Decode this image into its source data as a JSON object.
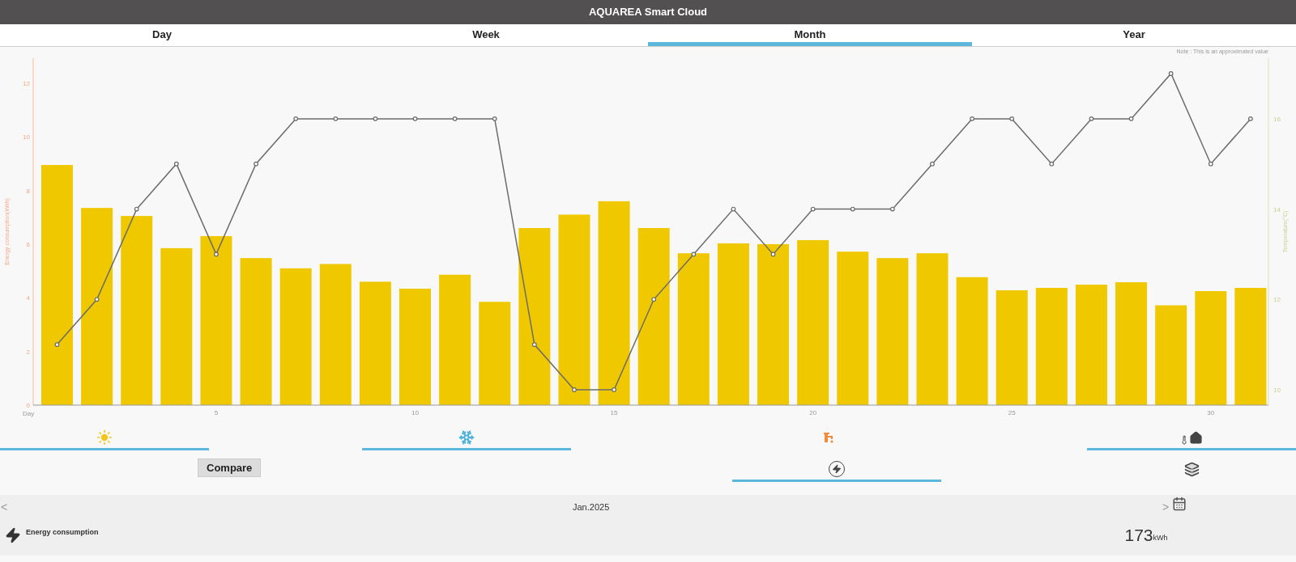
{
  "header": {
    "title": "AQUAREA Smart Cloud"
  },
  "tabs": [
    {
      "label": "Day",
      "selected": false
    },
    {
      "label": "Week",
      "selected": false
    },
    {
      "label": "Month",
      "selected": true
    },
    {
      "label": "Year",
      "selected": false
    }
  ],
  "main": {
    "note": "Note : This is an approximated value",
    "energy": {
      "chart_data": {
        "type": "bar",
        "xlabel": "Day",
        "ylabel": "Energy consumption(kWh)",
        "x": [
          1,
          2,
          3,
          4,
          5,
          6,
          7,
          8,
          9,
          10,
          11,
          12,
          13,
          14,
          15,
          16,
          17,
          18,
          19,
          20,
          21,
          22,
          23,
          24,
          25,
          26,
          27,
          28,
          29,
          30,
          31
        ],
        "xlim": [
          0.4,
          31.45
        ],
        "xticks": [
          5,
          10,
          15,
          20,
          25,
          30
        ],
        "ylim": [
          0,
          12.93
        ],
        "yticks": [
          0,
          2,
          4,
          6,
          8,
          10,
          12
        ],
        "series": [
          {
            "color": "#f0c800",
            "values": [
              8.95,
              7.35,
              7.05,
              5.85,
              6.3,
              5.48,
              5.1,
              5.26,
              4.6,
              4.34,
              4.86,
              3.85,
              6.6,
              7.1,
              7.6,
              6.6,
              5.66,
              6.03,
              6.0,
              6.15,
              5.72,
              5.48,
              5.66,
              4.77,
              4.28,
              4.37,
              4.49,
              4.58,
              3.72,
              4.25,
              4.37
            ]
          }
        ]
      }
    },
    "temperature": {
      "chart_data": {
        "type": "line",
        "ylabel": "Temperature(°C)",
        "x": [
          1,
          2,
          3,
          4,
          5,
          6,
          7,
          8,
          9,
          10,
          11,
          12,
          13,
          14,
          15,
          16,
          17,
          18,
          19,
          20,
          21,
          22,
          23,
          24,
          25,
          26,
          27,
          28,
          29,
          30,
          31
        ],
        "xlim": [
          0.4,
          31.45
        ],
        "ylim": [
          9.66,
          17.34
        ],
        "yticks": [
          10,
          12,
          14,
          16
        ],
        "series": [
          {
            "color": "#6b6b6b",
            "marker": "circle",
            "values": [
              11,
              12,
              14,
              15,
              13,
              15,
              16,
              16,
              16,
              16,
              16,
              16,
              11,
              10,
              10,
              12,
              13,
              14,
              13,
              14,
              14,
              14,
              15,
              16,
              16,
              15,
              16,
              16,
              17,
              15,
              16
            ]
          }
        ]
      }
    }
  },
  "modes": [
    {
      "kind": "heating",
      "selected": true
    },
    {
      "kind": "cooling",
      "selected": true
    },
    {
      "kind": "hot_water",
      "selected": false
    },
    {
      "kind": "room_temperature",
      "selected": true
    }
  ],
  "compare": {
    "label": "Compare"
  },
  "views": [
    {
      "kind": "energy",
      "selected": true
    },
    {
      "kind": "stack",
      "selected": false
    }
  ],
  "period": {
    "prev": "<",
    "label": "Jan.2025",
    "next": ">"
  },
  "summary": {
    "label": "Energy consumption",
    "value": "173",
    "unit": "kWh"
  }
}
